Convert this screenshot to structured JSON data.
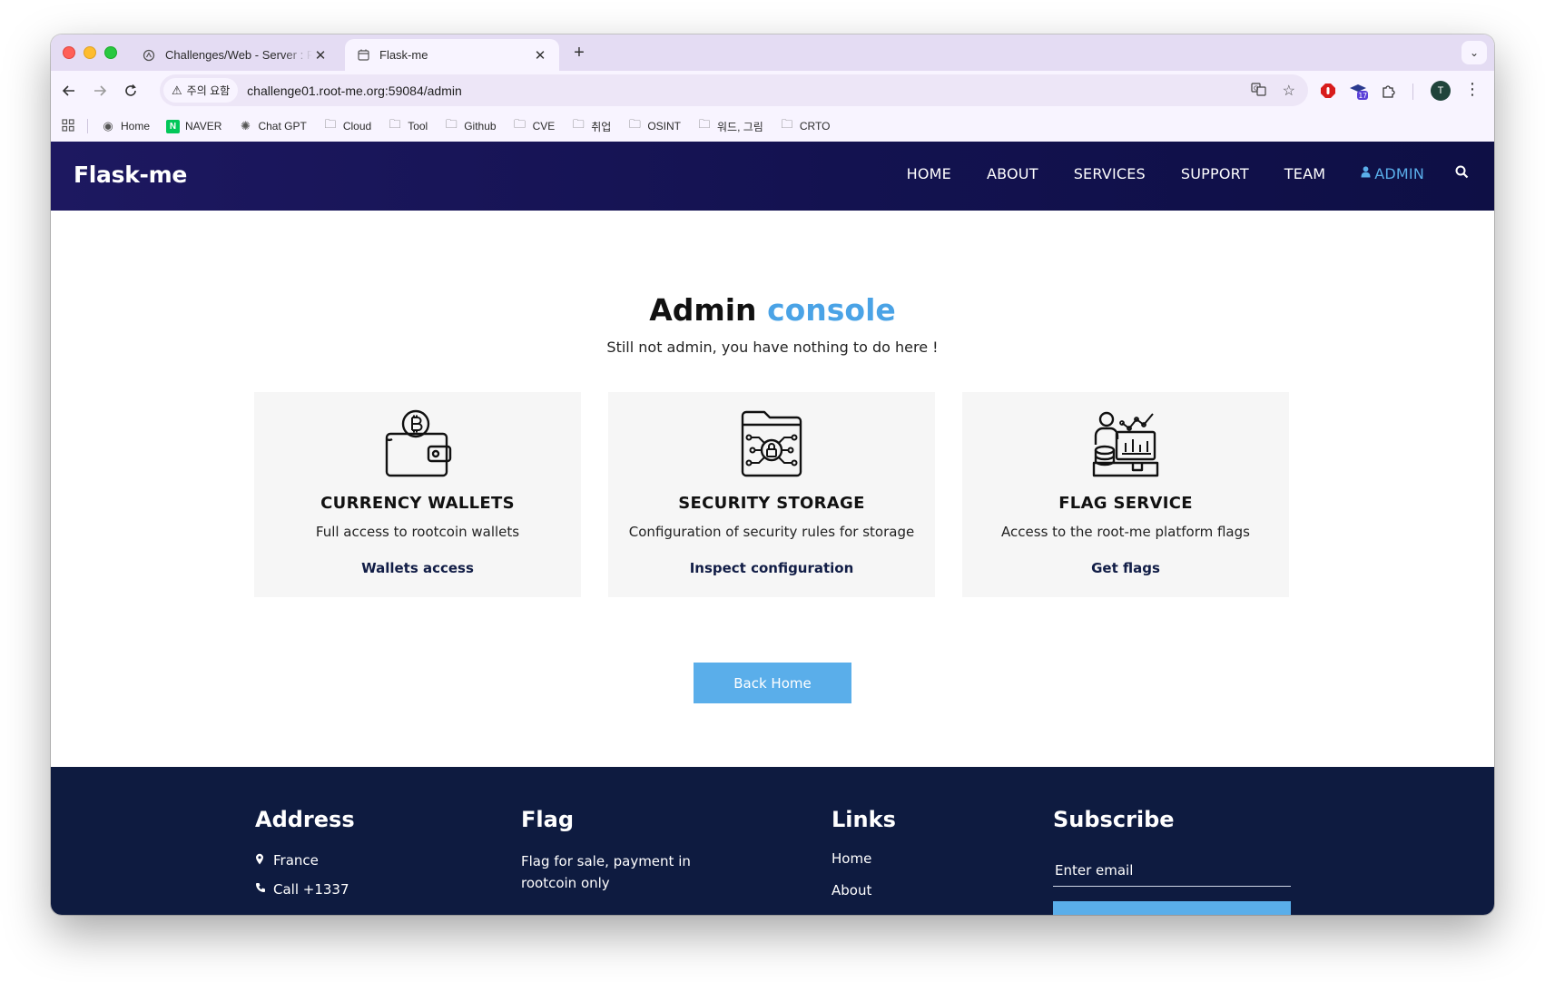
{
  "browser": {
    "tabs": [
      {
        "title": "Challenges/Web - Server : Flask-me",
        "active": false,
        "favicon": "root-me-favicon"
      },
      {
        "title": "Flask-me",
        "active": true,
        "favicon": "flask-favicon"
      }
    ],
    "new_tab": "+",
    "security_label": "주의 요함",
    "url": "challenge01.root-me.org:59084/admin",
    "profile_initial": "T",
    "extension_badge": "17",
    "bookmarks": [
      {
        "label": "Home",
        "icon": "chrome-icon"
      },
      {
        "label": "NAVER",
        "icon": "naver-icon"
      },
      {
        "label": "Chat GPT",
        "icon": "openai-icon"
      },
      {
        "label": "Cloud",
        "icon": "folder-icon"
      },
      {
        "label": "Tool",
        "icon": "folder-icon"
      },
      {
        "label": "Github",
        "icon": "folder-icon"
      },
      {
        "label": "CVE",
        "icon": "folder-icon"
      },
      {
        "label": "취업",
        "icon": "folder-icon"
      },
      {
        "label": "OSINT",
        "icon": "folder-icon"
      },
      {
        "label": "워드, 그림",
        "icon": "folder-icon"
      },
      {
        "label": "CRTO",
        "icon": "folder-icon"
      }
    ]
  },
  "site": {
    "brand": "Flask-me",
    "nav": {
      "home": "HOME",
      "about": "ABOUT",
      "services": "SERVICES",
      "support": "SUPPORT",
      "team": "TEAM",
      "admin": "ADMIN"
    },
    "accent_color": "#5aaeea",
    "nav_bg_color": "#131250"
  },
  "main": {
    "heading_part1": "Admin",
    "heading_part2": "console",
    "subtitle": "Still not admin, you have nothing to do here !",
    "cards": [
      {
        "title": "CURRENCY WALLETS",
        "description": "Full access to rootcoin wallets",
        "link": "Wallets access",
        "icon": "bitcoin-wallet-icon"
      },
      {
        "title": "SECURITY STORAGE",
        "description": "Configuration of security rules for storage",
        "link": "Inspect configuration",
        "icon": "secure-folder-icon"
      },
      {
        "title": "FLAG SERVICE",
        "description": "Access to the root-me platform flags",
        "link": "Get flags",
        "icon": "analytics-user-icon"
      }
    ],
    "back_button": "Back Home"
  },
  "footer": {
    "address_title": "Address",
    "address_location": "France",
    "address_phone": "Call +1337",
    "flag_title": "Flag",
    "flag_text": "Flag for sale, payment in rootcoin only",
    "links_title": "Links",
    "links": [
      "Home",
      "About"
    ],
    "subscribe_title": "Subscribe",
    "subscribe_placeholder": "Enter email",
    "bg_color": "#0e1b40"
  }
}
